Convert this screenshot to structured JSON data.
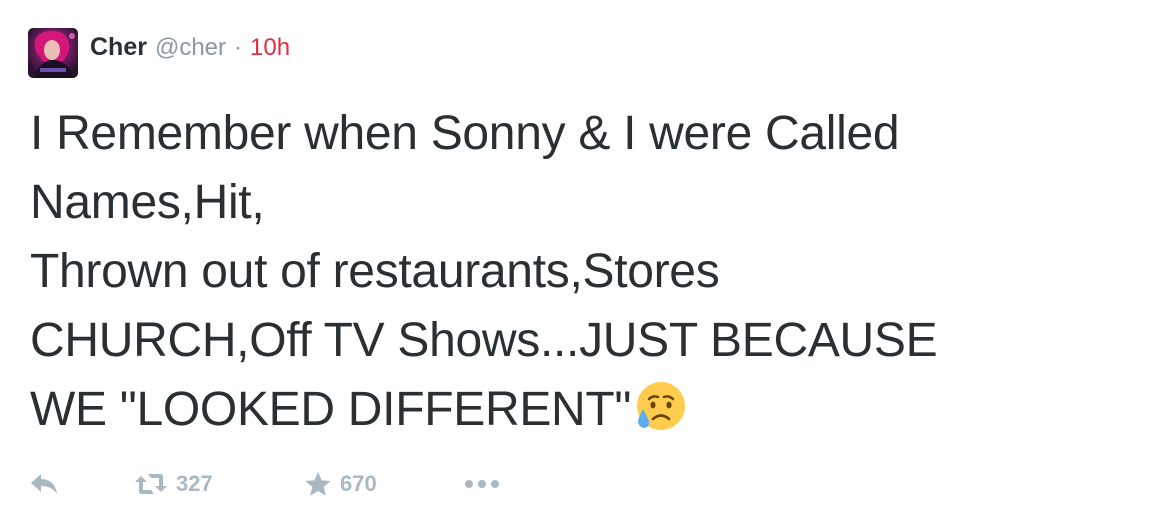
{
  "tweet": {
    "author": {
      "fullname": "Cher",
      "username": "@cher"
    },
    "separator": "·",
    "time": "10h",
    "text_lines": [
      "I Remember when Sonny & I were Called",
      "Names,Hit,",
      "Thrown out of restaurants,Stores",
      "CHURCH,Off TV Shows...JUST BECAUSE",
      "WE \"LOOKED DIFFERENT\""
    ],
    "emoji": "disappointed-but-relieved-face",
    "actions": {
      "reply_icon": "reply-icon",
      "retweet_icon": "retweet-icon",
      "retweet_count": "327",
      "favorite_icon": "star-icon",
      "favorite_count": "670",
      "more_icon": "ellipsis-icon"
    }
  },
  "colors": {
    "text": "#292f33",
    "muted": "#8899a6",
    "time": "#dd2e44",
    "action": "#aab8c2"
  }
}
